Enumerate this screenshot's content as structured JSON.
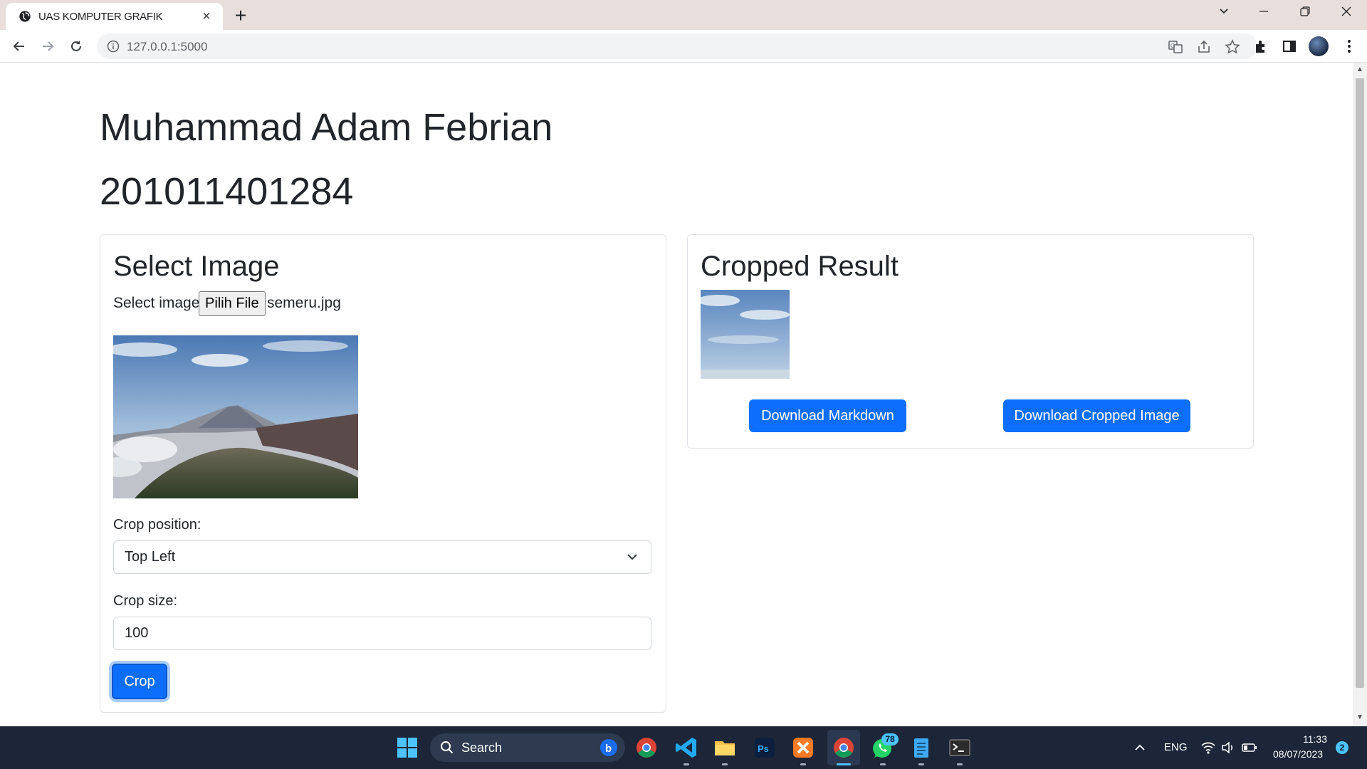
{
  "browser": {
    "tab_title": "UAS KOMPUTER GRAFIK",
    "url": "127.0.0.1:5000"
  },
  "page": {
    "name": "Muhammad Adam Febrian",
    "nim": "201011401284",
    "select_card": {
      "title": "Select Image",
      "select_label": "Select image:",
      "file_button": "Pilih File",
      "file_name": "semeru.jpg",
      "crop_position_label": "Crop position:",
      "crop_position_value": "Top Left",
      "crop_size_label": "Crop size:",
      "crop_size_value": "100",
      "crop_button": "Crop"
    },
    "result_card": {
      "title": "Cropped Result",
      "download_markdown": "Download Markdown",
      "download_image": "Download Cropped Image"
    }
  },
  "taskbar": {
    "search_label": "Search",
    "whatsapp_badge": "78",
    "language": "ENG",
    "time": "11:33",
    "date": "08/07/2023",
    "notification_count": "2"
  },
  "colors": {
    "primary": "#0d6efd",
    "taskbar": "#1c2638",
    "tabstrip": "#e8dedc"
  }
}
